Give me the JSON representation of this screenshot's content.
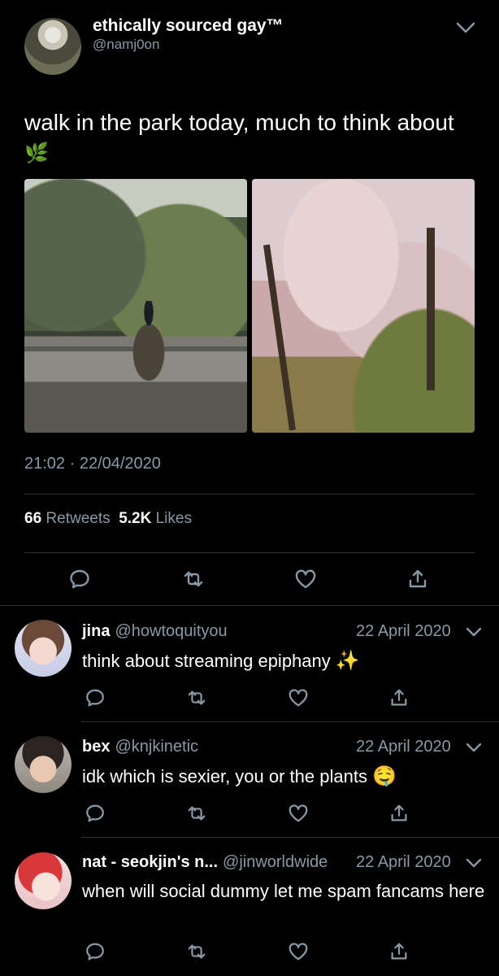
{
  "tweet": {
    "author_name": "ethically sourced gay™",
    "author_handle": "@namj0on",
    "text": "walk in the park today, much to think about",
    "text_emoji": "🌿",
    "timestamp": "21:02 · 22/04/2020",
    "retweets_count": "66",
    "retweets_label": "Retweets",
    "likes_count": "5.2K",
    "likes_label": "Likes"
  },
  "replies": [
    {
      "name": "jina",
      "handle": "@howtoquityou",
      "date": "22 April 2020",
      "text": "think about streaming epiphany",
      "emoji": "✨"
    },
    {
      "name": "bex",
      "handle": "@knjkinetic",
      "date": "22 April 2020",
      "text": "idk which is sexier, you or the plants",
      "emoji": "🤤"
    },
    {
      "name": "nat - seokjin's n...",
      "handle": "@jinworldwide",
      "date": "22 April 2020",
      "text": "when will social dummy let me spam fancams here",
      "emoji": ""
    }
  ],
  "colors": {
    "background": "#000000",
    "secondary_text": "#8899a6",
    "divider": "#2f3336"
  },
  "icons": [
    "chevron-down-icon",
    "reply-icon",
    "retweet-icon",
    "like-icon",
    "share-icon"
  ]
}
